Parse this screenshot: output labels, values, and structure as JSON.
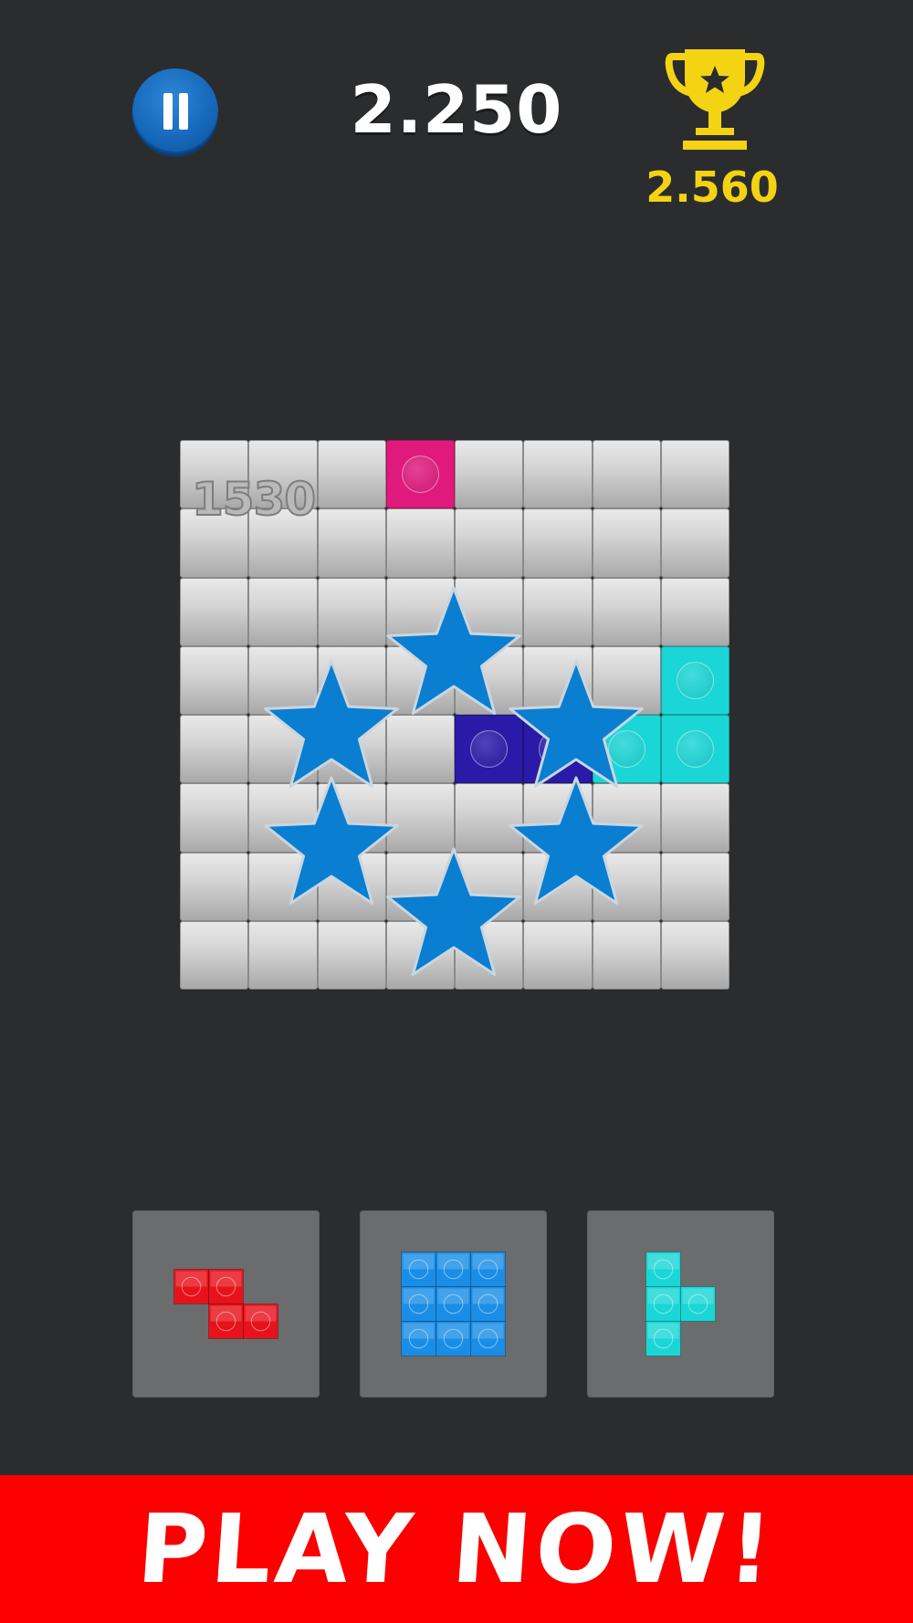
{
  "hud": {
    "score": "2.250",
    "best_score": "2.560",
    "pause_icon": "pause-icon",
    "trophy_icon": "trophy-icon"
  },
  "board": {
    "rows": 8,
    "cols": 8,
    "combo_text": "1530",
    "filled_cells": [
      {
        "row": 0,
        "col": 3,
        "color": "#e0197c"
      },
      {
        "row": 3,
        "col": 7,
        "color": "#1ad6d6"
      },
      {
        "row": 4,
        "col": 4,
        "color": "#2a1aa8"
      },
      {
        "row": 4,
        "col": 5,
        "color": "#2a1aa8"
      },
      {
        "row": 4,
        "col": 6,
        "color": "#1ad6d6"
      },
      {
        "row": 4,
        "col": 7,
        "color": "#1ad6d6"
      }
    ],
    "effect_icon": "star-icon",
    "effect_color": "#0a7ed0"
  },
  "tray": [
    {
      "name": "z-piece",
      "color": "#e8121a",
      "cells": [
        [
          0,
          0
        ],
        [
          0,
          1
        ],
        [
          1,
          1
        ],
        [
          1,
          2
        ]
      ]
    },
    {
      "name": "square-3x3-piece",
      "color": "#1a8ee6",
      "cells": [
        [
          0,
          0
        ],
        [
          0,
          1
        ],
        [
          0,
          2
        ],
        [
          1,
          0
        ],
        [
          1,
          1
        ],
        [
          1,
          2
        ],
        [
          2,
          0
        ],
        [
          2,
          1
        ],
        [
          2,
          2
        ]
      ]
    },
    {
      "name": "t-piece",
      "color": "#1ad6d6",
      "cells": [
        [
          0,
          0
        ],
        [
          1,
          0
        ],
        [
          1,
          1
        ],
        [
          2,
          0
        ]
      ]
    }
  ],
  "banner": {
    "label": "PLAY NOW!",
    "color": "#fc0000"
  }
}
